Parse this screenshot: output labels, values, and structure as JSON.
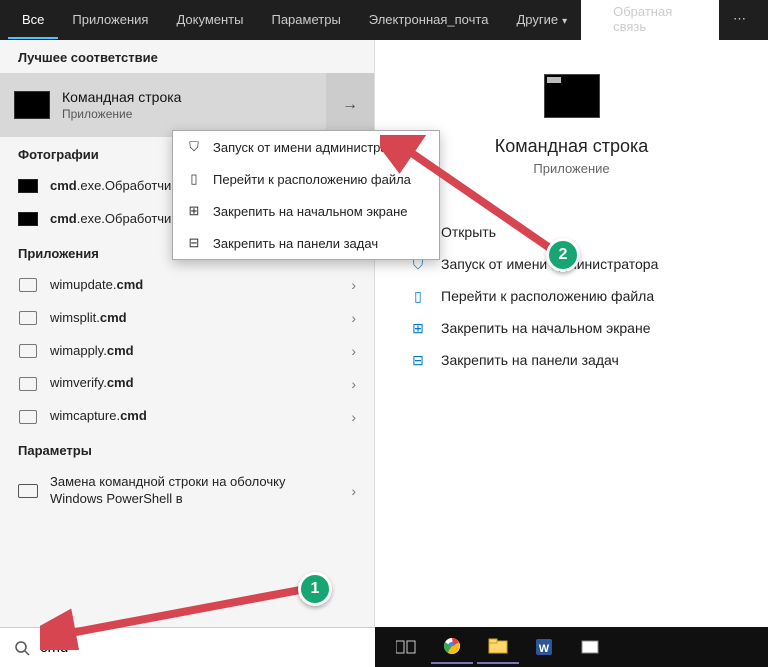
{
  "tabs": {
    "all": "Все",
    "apps": "Приложения",
    "docs": "Документы",
    "params": "Параметры",
    "email": "Электронная_почта",
    "other": "Другие",
    "feedback": "Обратная связь"
  },
  "sections": {
    "best": "Лучшее соответствие",
    "photos": "Фотографии",
    "apps": "Приложения",
    "params": "Параметры"
  },
  "best_match": {
    "title": "Командная строка",
    "subtitle": "Приложение"
  },
  "context_menu": {
    "run_admin": "Запуск от имени администратора",
    "open_location": "Перейти к расположению файла",
    "pin_start": "Закрепить на начальном экране",
    "pin_taskbar": "Закрепить на панели задач"
  },
  "photos": {
    "p1a": "cmd",
    "p1b": ".exe.Обработчик Windows.Microsoft",
    "p2a": "cmd",
    "p2b": ".exe.Обработчик команд Windows.Microsoft"
  },
  "app_items": {
    "a1a": "wimupdate.",
    "a1b": "cmd",
    "a2a": "wimsplit.",
    "a2b": "cmd",
    "a3a": "wimapply.",
    "a3b": "cmd",
    "a4a": "wimverify.",
    "a4b": "cmd",
    "a5a": "wimcapture.",
    "a5b": "cmd"
  },
  "param_item": "Замена командной строки на оболочку Windows PowerShell в",
  "detail": {
    "title": "Командная строка",
    "subtitle": "Приложение",
    "open": "Открыть",
    "run_admin": "Запуск от имени администратора",
    "open_location": "Перейти к расположению файла",
    "pin_start": "Закрепить на начальном экране",
    "pin_taskbar": "Закрепить на панели задач"
  },
  "search": {
    "value": "cmd"
  },
  "annotations": {
    "one": "1",
    "two": "2"
  }
}
